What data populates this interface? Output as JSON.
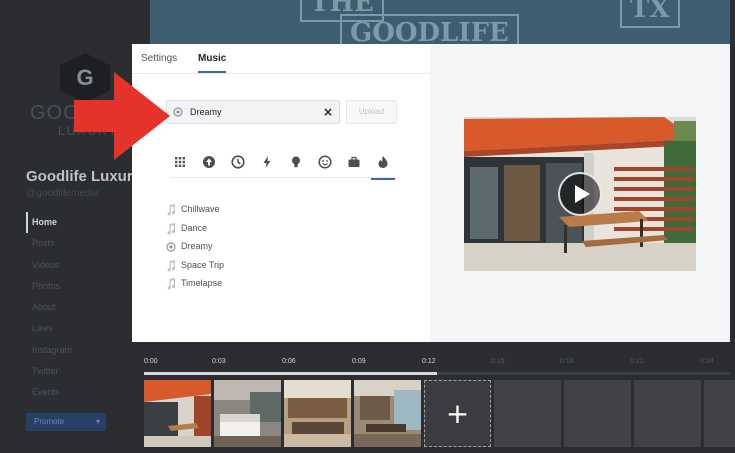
{
  "background": {
    "cover_tags": [
      "THE",
      "GOODLIFE",
      "TX"
    ],
    "logo_letter": "G",
    "brand_line1": "GOODLIFE",
    "brand_line2": "LUXURY",
    "page_name": "Goodlife Luxury",
    "page_handle": "@goodlifemedia",
    "nav_items": [
      "Home",
      "Posts",
      "Videos",
      "Photos",
      "About",
      "Likes",
      "Instagram",
      "Twitter",
      "Events"
    ],
    "promote_label": "Promote",
    "promote_caret": "▾"
  },
  "modal": {
    "tabs": [
      {
        "label": "Settings",
        "active": false
      },
      {
        "label": "Music",
        "active": true
      }
    ],
    "search": {
      "value": "Dreamy",
      "clear_icon": "×"
    },
    "upload_label": "Upload",
    "categories": [
      {
        "icon": "grid-icon",
        "active": false
      },
      {
        "icon": "upload-arrow-icon",
        "active": false
      },
      {
        "icon": "clock-icon",
        "active": false
      },
      {
        "icon": "lightning-icon",
        "active": false
      },
      {
        "icon": "lightbulb-icon",
        "active": false
      },
      {
        "icon": "smiley-icon",
        "active": false
      },
      {
        "icon": "briefcase-icon",
        "active": false
      },
      {
        "icon": "flame-icon",
        "active": true
      }
    ],
    "tracks": [
      {
        "name": "Chillwave",
        "icon": "music-note-icon"
      },
      {
        "name": "Dance",
        "icon": "music-note-icon"
      },
      {
        "name": "Dreamy",
        "icon": "mood-icon"
      },
      {
        "name": "Space Trip",
        "icon": "music-note-icon"
      },
      {
        "name": "Timelapse",
        "icon": "music-note-icon"
      }
    ]
  },
  "timeline": {
    "ticks": [
      "0:00",
      "0:03",
      "0:06",
      "0:09",
      "0:12"
    ],
    "dim_ticks": [
      "0:15",
      "0:18",
      "0:21",
      "0:24"
    ],
    "progress_fraction": 0.5,
    "add_label": "+"
  },
  "colors": {
    "accent": "#4267b2",
    "arrow": "#e5322b",
    "modal_bg": "#ffffff",
    "dim_bg": "#2b2d30"
  }
}
